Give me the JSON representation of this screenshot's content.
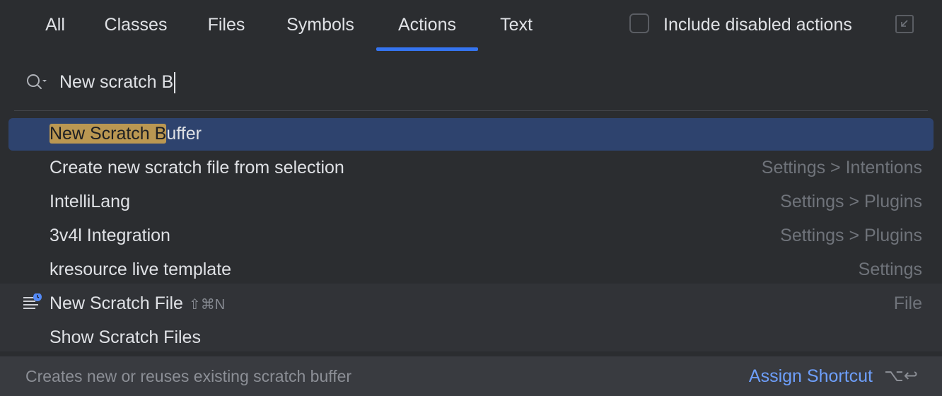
{
  "tabs": [
    {
      "label": "All"
    },
    {
      "label": "Classes"
    },
    {
      "label": "Files"
    },
    {
      "label": "Symbols"
    },
    {
      "label": "Actions",
      "active": true
    },
    {
      "label": "Text"
    }
  ],
  "options": {
    "include_disabled_label": "Include disabled actions",
    "include_disabled_checked": false
  },
  "search": {
    "query": "New scratch B"
  },
  "results": [
    {
      "label_highlight": "New Scratch B",
      "label_rest": "uffer",
      "location": "",
      "selected": true
    },
    {
      "label": "Create new scratch file from selection",
      "location": "Settings > Intentions"
    },
    {
      "label": "IntelliLang",
      "location": "Settings > Plugins"
    },
    {
      "label": "3v4l Integration",
      "location": "Settings > Plugins"
    },
    {
      "label": "kresource live template",
      "location": "Settings"
    },
    {
      "label": "New Scratch File",
      "shortcut": "⇧⌘N",
      "location": "File",
      "icon": "scratch-file-icon"
    },
    {
      "label": "Show Scratch Files",
      "location": ""
    }
  ],
  "footer": {
    "hint": "Creates new or reuses existing scratch buffer",
    "assign_label": "Assign Shortcut",
    "assign_keys": "⌥↩"
  },
  "colors": {
    "accent": "#3574f0",
    "selection": "#2e436e",
    "match_highlight": "#ba9752",
    "link": "#6e9ffb"
  }
}
